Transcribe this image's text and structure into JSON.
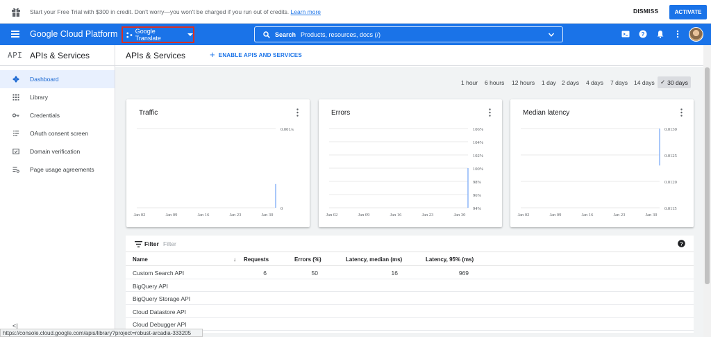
{
  "trial_banner": {
    "message": "Start your Free Trial with $300 in credit. Don't worry—you won't be charged if you run out of credits.",
    "learn_more": "Learn more",
    "dismiss": "DISMISS",
    "activate": "ACTIVATE"
  },
  "topbar": {
    "brand": "Google Cloud Platform",
    "project": "Google Translate",
    "search_label": "Search",
    "search_placeholder": "Products, resources, docs (/)",
    "accent": "#1a73e8"
  },
  "sidebar": {
    "logo": "API",
    "title": "APIs & Services",
    "items": [
      {
        "label": "Dashboard",
        "icon": "dashboard-diamond-icon",
        "active": true
      },
      {
        "label": "Library",
        "icon": "library-grid-icon",
        "active": false
      },
      {
        "label": "Credentials",
        "icon": "key-icon",
        "active": false
      },
      {
        "label": "OAuth consent screen",
        "icon": "consent-icon",
        "active": false
      },
      {
        "label": "Domain verification",
        "icon": "domain-check-icon",
        "active": false
      },
      {
        "label": "Page usage agreements",
        "icon": "settings-list-icon",
        "active": false
      }
    ],
    "collapse": "<|"
  },
  "main": {
    "title": "APIs & Services",
    "enable_button": "ENABLE APIS AND SERVICES",
    "time_ranges": [
      "1 hour",
      "6 hours",
      "12 hours",
      "1 day",
      "2 days",
      "4 days",
      "7 days",
      "14 days",
      "30 days"
    ],
    "selected_range": "30 days",
    "selected_check": "✓"
  },
  "chart_data": [
    {
      "type": "line",
      "title": "Traffic",
      "x_ticks": [
        "Jan 02",
        "Jan 09",
        "Jan 16",
        "Jan 23",
        "Jan 30"
      ],
      "y_ticks": [
        "0.001/s",
        "0"
      ],
      "series": [
        {
          "values": [
            {
              "x": "Jan 30",
              "y_from": 0,
              "y_to": 0.0003
            }
          ]
        }
      ],
      "ylim": [
        0,
        0.001
      ]
    },
    {
      "type": "line",
      "title": "Errors",
      "x_ticks": [
        "Jan 02",
        "Jan 09",
        "Jan 16",
        "Jan 23",
        "Jan 30"
      ],
      "y_ticks": [
        "106%",
        "104%",
        "102%",
        "100%",
        "98%",
        "96%",
        "94%"
      ],
      "series": [
        {
          "values": [
            {
              "x": "Jan 30",
              "y_from": 94,
              "y_to": 100
            }
          ]
        }
      ],
      "ylim": [
        94,
        106
      ]
    },
    {
      "type": "line",
      "title": "Median latency",
      "x_ticks": [
        "Jan 02",
        "Jan 09",
        "Jan 16",
        "Jan 23",
        "Jan 30"
      ],
      "y_ticks": [
        "0.0130",
        "0.0125",
        "0.0120",
        "0.0115"
      ],
      "series": [
        {
          "values": [
            {
              "x": "Jan 30",
              "y_from": 0.0123,
              "y_to": 0.013
            }
          ]
        }
      ],
      "ylim": [
        0.0115,
        0.013
      ]
    }
  ],
  "table": {
    "filter_label": "Filter",
    "filter_placeholder": "Filter",
    "columns": [
      "Name",
      "Requests",
      "Errors (%)",
      "Latency, median (ms)",
      "Latency, 95% (ms)"
    ],
    "sort_arrow": "↓",
    "rows": [
      {
        "name": "Custom Search API",
        "requests": "6",
        "errors": "50",
        "lat_median": "16",
        "lat_95": "969"
      },
      {
        "name": "BigQuery API",
        "requests": "",
        "errors": "",
        "lat_median": "",
        "lat_95": ""
      },
      {
        "name": "BigQuery Storage API",
        "requests": "",
        "errors": "",
        "lat_median": "",
        "lat_95": ""
      },
      {
        "name": "Cloud Datastore API",
        "requests": "",
        "errors": "",
        "lat_median": "",
        "lat_95": ""
      },
      {
        "name": "Cloud Debugger API",
        "requests": "",
        "errors": "",
        "lat_median": "",
        "lat_95": ""
      }
    ]
  },
  "status_url": "https://console.cloud.google.com/apis/library?project=robust-arcadia-333205"
}
